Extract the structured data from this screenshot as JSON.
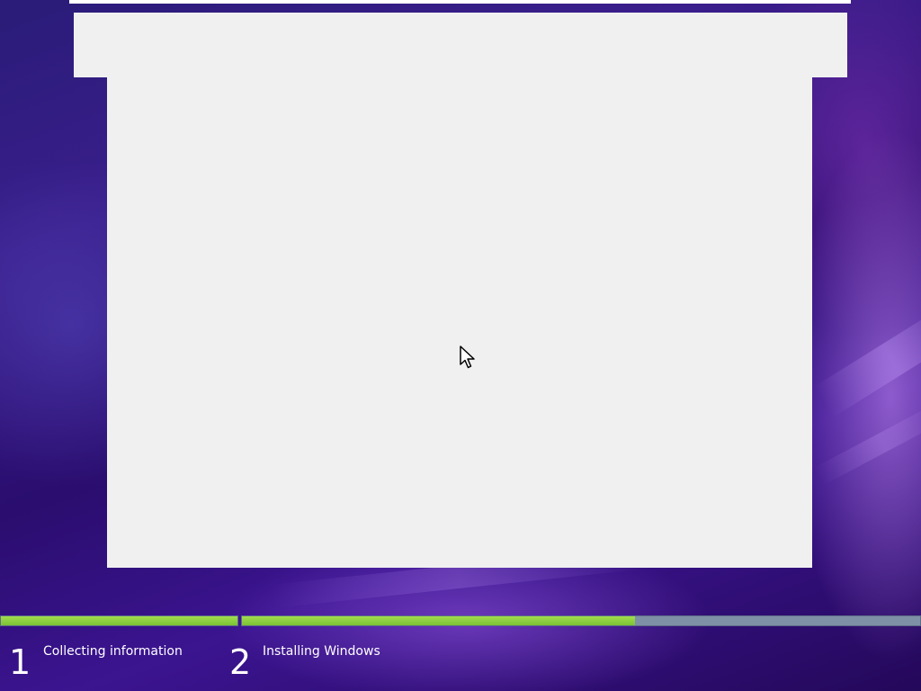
{
  "setup": {
    "steps": [
      {
        "number": "1",
        "label": "Collecting information",
        "progress": 1.0
      },
      {
        "number": "2",
        "label": "Installing Windows",
        "progress": 0.58
      }
    ]
  },
  "colors": {
    "progress_fill": "#8fcf3f",
    "progress_track": "#7e90a6",
    "window_bg": "#f0f0f0",
    "step_text": "#ffffff"
  },
  "icons": {
    "cursor": "mouse-pointer-icon"
  }
}
